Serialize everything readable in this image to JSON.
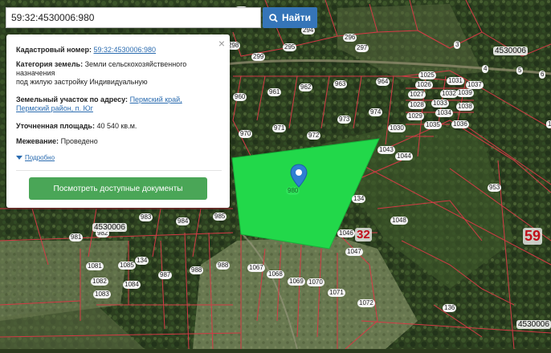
{
  "search": {
    "value": "59:32:4530006:980",
    "button_label": "Найти"
  },
  "info_panel": {
    "close_symbol": "×",
    "cadastral_number_label": "Кадастровый номер:",
    "cadastral_number_value": "59:32:4530006:980",
    "land_category_label": "Категория земель:",
    "land_category_value": "Земли сельскохозяйственного назначения",
    "land_use_value": "под жилую застройку Индивидуальную",
    "address_label": "Земельный участок по адресу:",
    "address_value": "Пермский край, Пермский район, п. Юг",
    "area_label": "Уточненная площадь:",
    "area_value": "40 540 кв.м.",
    "survey_label": "Межевание:",
    "survey_value": "Проведено",
    "more_link": "Подробно",
    "docs_button": "Посмотреть доступные документы"
  },
  "map": {
    "colors": {
      "selected_parcel": "#22d84a",
      "parcel_border": "#d43a45",
      "forest": "#2e4221",
      "field": "#6e7d52"
    },
    "marker_icon": "map-pin-icon",
    "selected_parcel_label": "980",
    "quarter_labels": [
      "4530006",
      "4530006",
      "4530006"
    ],
    "big_labels": [
      "32",
      "59"
    ],
    "parcel_labels": [
      "293",
      "294",
      "298",
      "299",
      "295",
      "296",
      "297",
      "3",
      "4",
      "5",
      "6",
      "960",
      "961",
      "962",
      "963",
      "964",
      "1025",
      "1031",
      "1026",
      "1037",
      "1027",
      "1032",
      "1028",
      "1033",
      "1038",
      "1039",
      "1029",
      "1034",
      "1030",
      "1035",
      "970",
      "971",
      "972",
      "973",
      "974",
      "1043",
      "1044",
      "1036",
      "953",
      "983",
      "984",
      "985",
      "981",
      "982",
      "134",
      "1046",
      "1048",
      "1047",
      "1081",
      "1085",
      "134",
      "1082",
      "1084",
      "1083",
      "987",
      "988",
      "988",
      "1067",
      "1068",
      "1069",
      "1070",
      "1071",
      "1072",
      "136",
      "1"
    ]
  }
}
